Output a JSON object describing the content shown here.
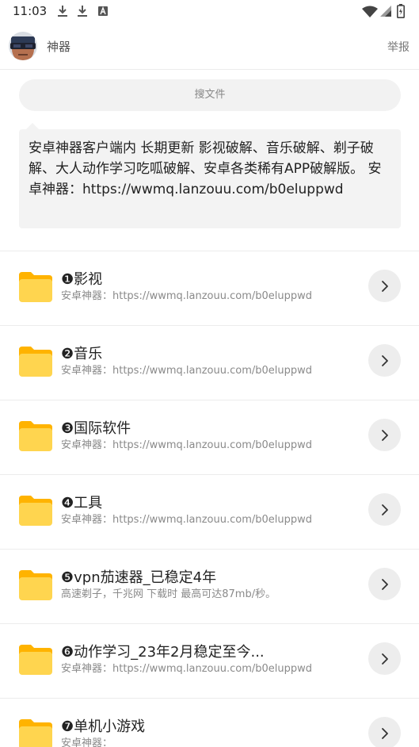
{
  "status_bar": {
    "time": "11:03",
    "icons": [
      "download-icon",
      "download-icon",
      "notification-a-icon",
      "wifi-icon",
      "signal-icon",
      "battery-icon"
    ]
  },
  "header": {
    "title": "神器",
    "report": "举报"
  },
  "search": {
    "placeholder": "搜文件"
  },
  "description": {
    "text": "安卓神器客户端内 长期更新 影视破解、音乐破解、剃子破解、大人动作学习吃呱破解、安卓各类稀有APP破解版。 安卓神器：https://wwmq.lanzouu.com/b0eluppwd"
  },
  "folders": [
    {
      "title": "❶影视",
      "subtitle": "安卓神器：https://wwmq.lanzouu.com/b0eluppwd"
    },
    {
      "title": "❷音乐",
      "subtitle": "安卓神器：https://wwmq.lanzouu.com/b0eluppwd"
    },
    {
      "title": "❸国际软件",
      "subtitle": "安卓神器：https://wwmq.lanzouu.com/b0eluppwd"
    },
    {
      "title": "❹工具",
      "subtitle": "安卓神器：https://wwmq.lanzouu.com/b0eluppwd"
    },
    {
      "title": "❺vpn茄速器_已稳定4年",
      "subtitle": "高速剃子，千兆网 下载时 最高可达87mb/秒。"
    },
    {
      "title": "❻动作学习_23年2月稳定至今...",
      "subtitle": "安卓神器：https://wwmq.lanzouu.com/b0eluppwd"
    },
    {
      "title": "❼单机小游戏",
      "subtitle": "安卓神器："
    }
  ],
  "colors": {
    "folder": "#FFD54F",
    "folder_tab": "#FFB300",
    "accent_gray": "#EDEDED"
  }
}
